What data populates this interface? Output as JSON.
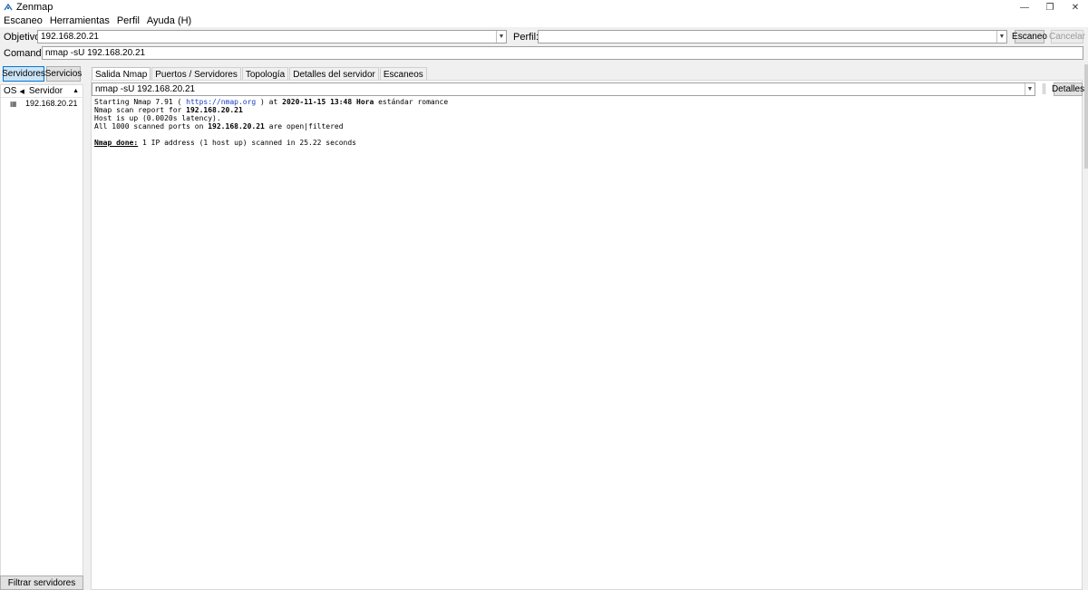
{
  "window": {
    "title": "Zenmap"
  },
  "menu": [
    "Escaneo",
    "Herramientas",
    "Perfil",
    "Ayuda (H)"
  ],
  "target": {
    "label": "Objetivo:",
    "value": "192.168.20.21"
  },
  "profile": {
    "label": "Perfil:",
    "value": ""
  },
  "buttons": {
    "scan": "Escaneo",
    "cancel": "Cancelar",
    "details": "Detalles",
    "filter_hosts": "Filtrar servidores"
  },
  "command": {
    "label": "Comando:",
    "value": "nmap -sU 192.168.20.21"
  },
  "sidebar": {
    "tabs": [
      "Servidores",
      "Servicios"
    ],
    "columns": {
      "os": "OS",
      "host": "Servidor"
    },
    "hosts": [
      "192.168.20.21"
    ]
  },
  "tabs": [
    "Salida Nmap",
    "Puertos / Servidores",
    "Topología",
    "Detalles del servidor",
    "Escaneos"
  ],
  "output_select": "nmap -sU 192.168.20.21",
  "output": {
    "line1_pre": "Starting Nmap 7.91 ( ",
    "line1_link": "https://nmap.org",
    "line1_mid": " ) at ",
    "line1_date": "2020-11-15 13:48 Hora",
    "line1_post": " estándar romance",
    "line2_pre": "Nmap scan report for ",
    "line2_ip": "192.168.20.21",
    "line3": "Host is up (0.0020s latency).",
    "line4_pre": "All 1000 scanned ports on ",
    "line4_ip": "192.168.20.21",
    "line4_post": " are open|filtered",
    "line6_done": "Nmap done:",
    "line6_post": " 1 IP address (1 host up) scanned in 25.22 seconds"
  }
}
